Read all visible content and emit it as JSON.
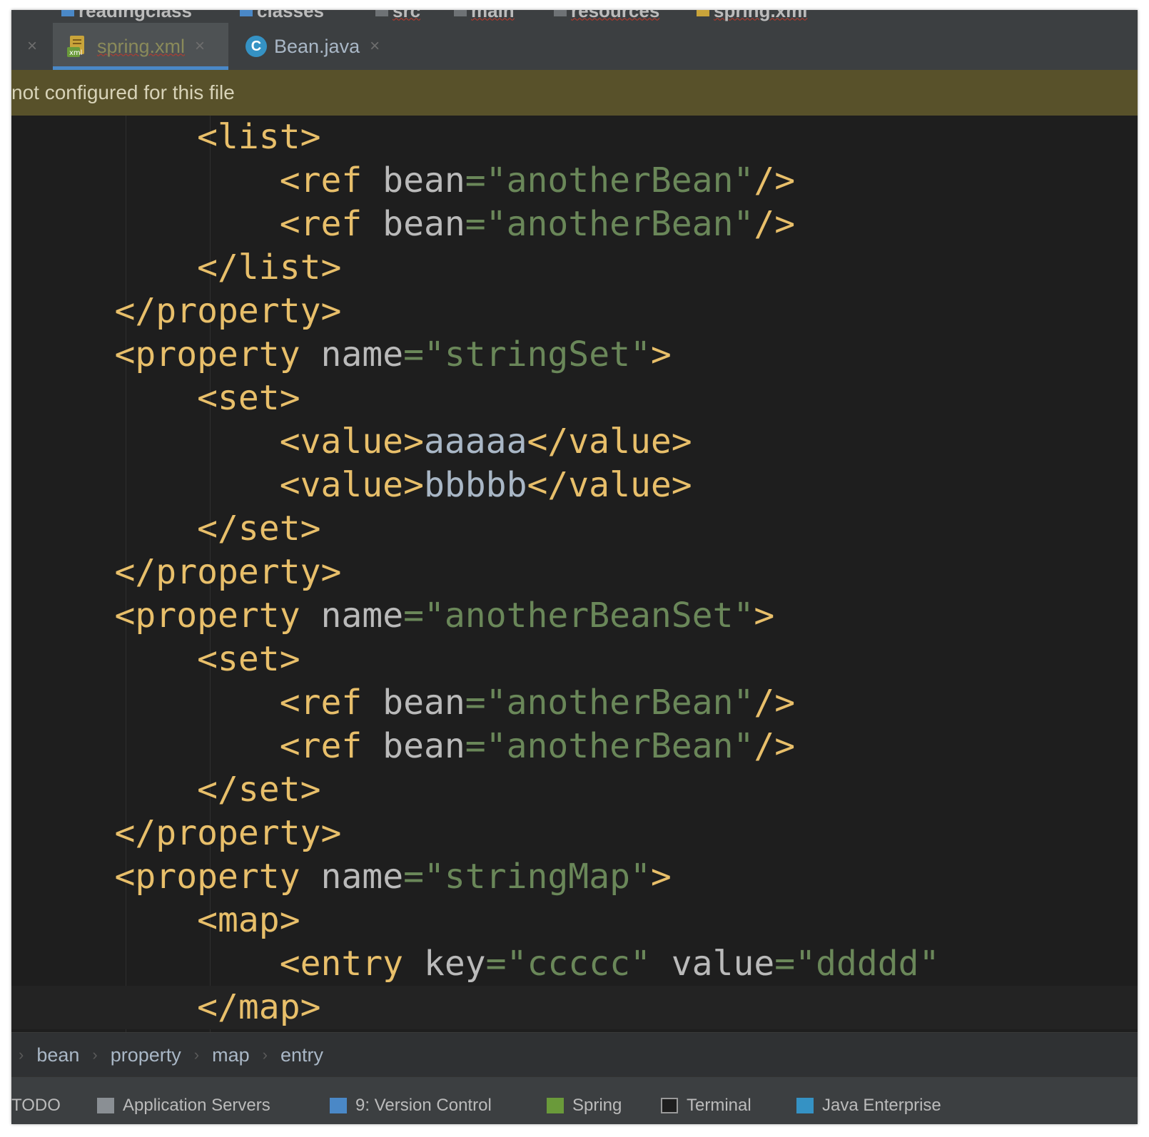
{
  "navbar": {
    "crumbs": [
      "readingclass",
      "classes",
      "src",
      "main",
      "resources",
      "spring.xml"
    ]
  },
  "tabs": [
    {
      "label": "spring.xml",
      "close": "×",
      "active": true
    },
    {
      "label": "Bean.java",
      "close": "×",
      "active": false,
      "icon_letter": "C"
    }
  ],
  "banner": {
    "text": "not configured for this file"
  },
  "code": {
    "lines": [
      "    <list>",
      "        <ref bean=\"anotherBean\"/>",
      "        <ref bean=\"anotherBean\"/>",
      "    </list>",
      "</property>",
      "<property name=\"stringSet\">",
      "    <set>",
      "        <value>aaaaa</value>",
      "        <value>bbbbb</value>",
      "    </set>",
      "</property>",
      "<property name=\"anotherBeanSet\">",
      "    <set>",
      "        <ref bean=\"anotherBean\"/>",
      "        <ref bean=\"anotherBean\"/>",
      "    </set>",
      "</property>",
      "<property name=\"stringMap\">",
      "    <map>",
      "        <entry key=\"ccccc\" value=\"ddddd\"",
      "    </map>"
    ],
    "current_line": 20
  },
  "breadcrumbs": [
    "bean",
    "property",
    "map",
    "entry"
  ],
  "tool_windows": [
    "TODO",
    "Application Servers",
    "9: Version Control",
    "Spring",
    "Terminal",
    "Java Enterprise"
  ],
  "colors": {
    "tag": "#e8bf6a",
    "attribute": "#bababa",
    "string": "#6a8759",
    "text": "#a9b7c6",
    "banner": "#58512a",
    "editor_bg": "#1e1e1e",
    "active_tab_underline": "#4a88c7"
  }
}
